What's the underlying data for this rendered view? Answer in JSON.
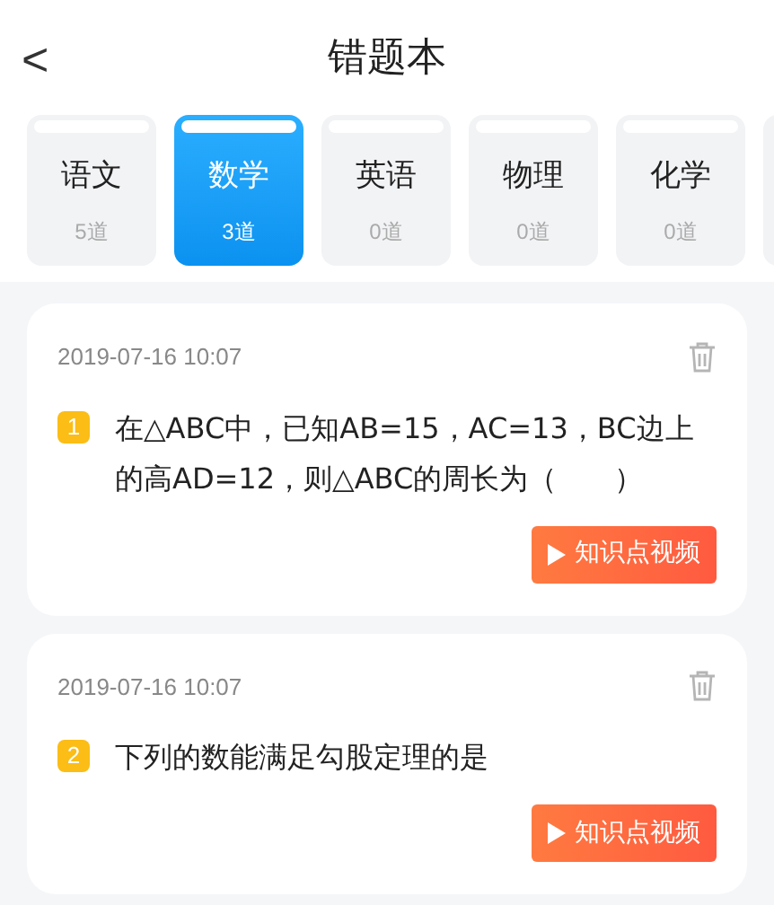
{
  "header": {
    "back": "<",
    "title": "错题本"
  },
  "subjects": [
    {
      "name": "语文",
      "count": "5道",
      "selected": false
    },
    {
      "name": "数学",
      "count": "3道",
      "selected": true
    },
    {
      "name": "英语",
      "count": "0道",
      "selected": false
    },
    {
      "name": "物理",
      "count": "0道",
      "selected": false
    },
    {
      "name": "化学",
      "count": "0道",
      "selected": false
    }
  ],
  "questions": [
    {
      "date": "2019-07-16 10:07",
      "number": "1",
      "text": "在△ABC中，已知AB=15，AC=13，BC边上的高AD=12，则△ABC的周长为（　　）",
      "button": "知识点视频"
    },
    {
      "date": "2019-07-16 10:07",
      "number": "2",
      "text": "下列的数能满足勾股定理的是",
      "button": "知识点视频"
    }
  ]
}
